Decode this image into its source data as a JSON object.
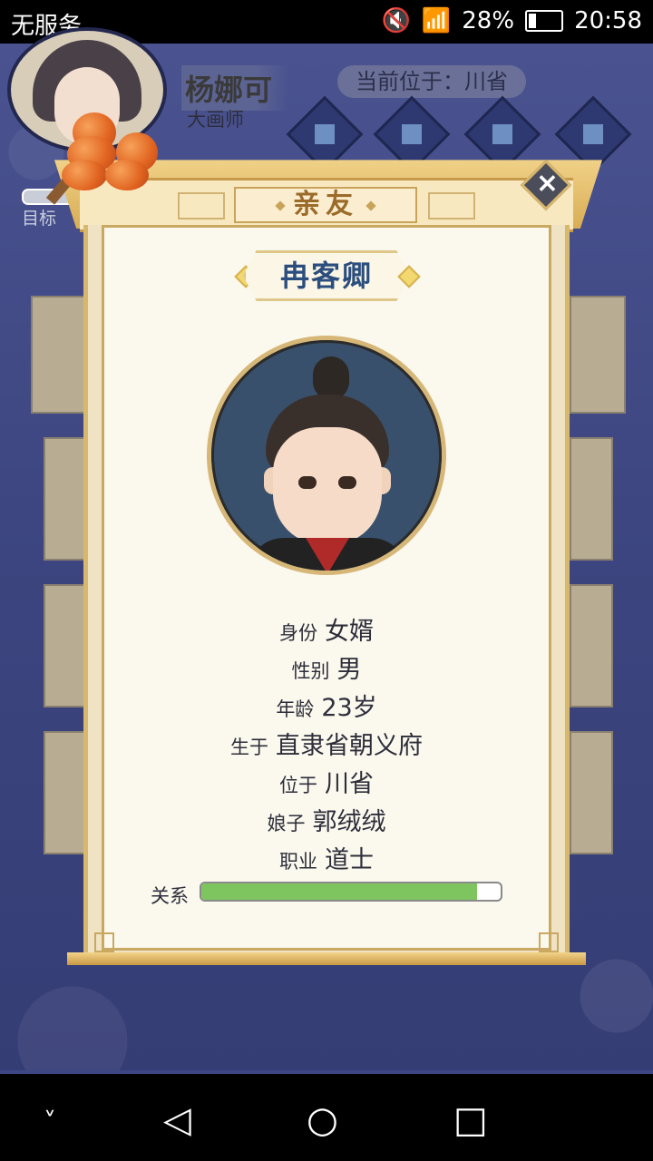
{
  "status_bar": {
    "carrier": "无服务",
    "battery": "28%",
    "time": "20:58"
  },
  "header": {
    "player_name": "杨娜可",
    "player_title": "大画师",
    "location": "当前位于：川省",
    "target_label": "目标"
  },
  "dialog": {
    "tab_title": "亲友",
    "close_label": "×",
    "name": "冉客卿",
    "fields": [
      {
        "label": "身份",
        "value": "女婿"
      },
      {
        "label": "性别",
        "value": "男"
      },
      {
        "label": "年龄",
        "value": "23岁"
      },
      {
        "label": "生于",
        "value": "直隶省朝义府"
      },
      {
        "label": "位于",
        "value": "川省"
      },
      {
        "label": "娘子",
        "value": "郭绒绒"
      },
      {
        "label": "职业",
        "value": "道士"
      }
    ],
    "relationship_label": "关系",
    "relationship_level": 0.92
  },
  "nav": {
    "back_icon": "back-triangle-icon",
    "home_icon": "home-circle-icon",
    "recent_icon": "recent-square-icon"
  },
  "colors": {
    "accent_gold": "#d8b86d",
    "name_blue": "#2c4e7e",
    "progress_green": "#7ec560"
  }
}
